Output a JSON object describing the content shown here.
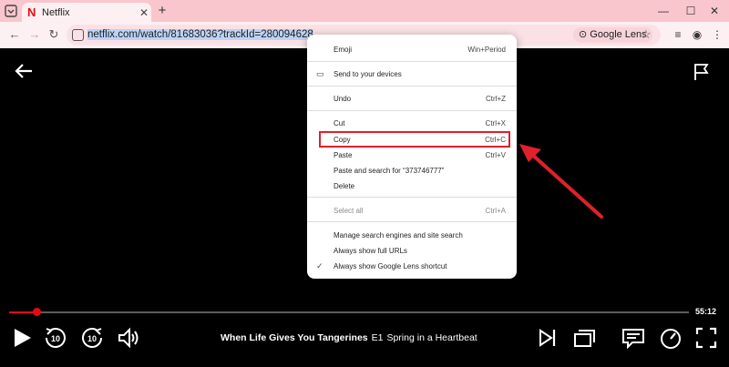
{
  "browser": {
    "tab_title": "Netflix",
    "tab_logo": "N",
    "new_tab_label": "+",
    "url_host": "netflix.com",
    "url_path": "/watch/81683036?trackId=280094628",
    "lens_label": "Google Lens",
    "icons": [
      "tab-grid-icon",
      "close-icon",
      "minimize-icon",
      "maximize-icon",
      "window-close-icon",
      "back-icon",
      "forward-icon",
      "reload-icon",
      "site-info-icon",
      "star-icon",
      "media-icon",
      "profile-icon",
      "more-icon"
    ]
  },
  "context_menu": {
    "items": [
      {
        "label": "Emoji",
        "shortcut": "Win+Period"
      },
      {
        "label": "Send to your devices",
        "shortcut": ""
      },
      {
        "label": "Undo",
        "shortcut": "Ctrl+Z"
      },
      {
        "label": "Cut",
        "shortcut": "Ctrl+X"
      },
      {
        "label": "Copy",
        "shortcut": "Ctrl+C"
      },
      {
        "label": "Paste",
        "shortcut": "Ctrl+V"
      },
      {
        "label": "Paste and search for “373746777”",
        "shortcut": ""
      },
      {
        "label": "Delete",
        "shortcut": ""
      },
      {
        "label": "Select all",
        "shortcut": "Ctrl+A"
      },
      {
        "label": "Manage search engines and site search",
        "shortcut": ""
      },
      {
        "label": "Always show full URLs",
        "shortcut": ""
      },
      {
        "label": "Always show Google Lens shortcut",
        "shortcut": ""
      }
    ],
    "highlighted_item": "Copy"
  },
  "player": {
    "progress": 0.04,
    "time_remaining": "55:12",
    "show_title": "When Life Gives You Tangerines",
    "episode": "E1",
    "episode_title": "Spring in a Heartbeat",
    "skip_back_label": "10",
    "skip_forward_label": "10",
    "accent_color": "#e50914"
  },
  "colors": {
    "tab_bar": "#f9c6cd",
    "toolbar": "#fdf0f2",
    "annotation": "#e0202a"
  }
}
